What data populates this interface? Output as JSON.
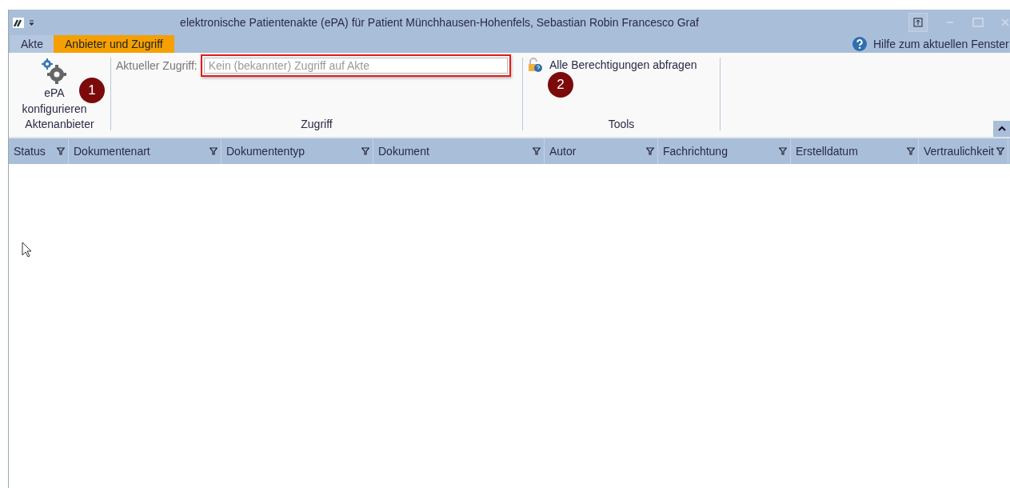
{
  "window": {
    "title": "elektronische Patientenakte (ePA) für Patient Münchhausen-Hohenfels, Sebastian Robin Francesco Graf"
  },
  "tabs": [
    {
      "label": "Akte",
      "selected": false
    },
    {
      "label": "Anbieter und Zugriff",
      "selected": true
    }
  ],
  "help": "Hilfe zum aktuellen Fenster",
  "ribbon": {
    "groups": [
      {
        "kind": "button",
        "caption": "Aktenanbieter",
        "label": "ePA konfigurieren",
        "callout": "1"
      },
      {
        "kind": "field",
        "caption": "Zugriff",
        "label": "Aktueller Zugriff:",
        "placeholder": "Kein (bekannter) Zugriff auf Akte",
        "highlighted": true
      },
      {
        "kind": "link",
        "caption": "Tools",
        "label": "Alle Berechtigungen abfragen",
        "callout": "2"
      }
    ]
  },
  "table": {
    "columns": [
      "Status",
      "Dokumentenart",
      "Dokumententyp",
      "Dokument",
      "Autor",
      "Fachrichtung",
      "Erstelldatum",
      "Vertraulichkeit"
    ]
  }
}
